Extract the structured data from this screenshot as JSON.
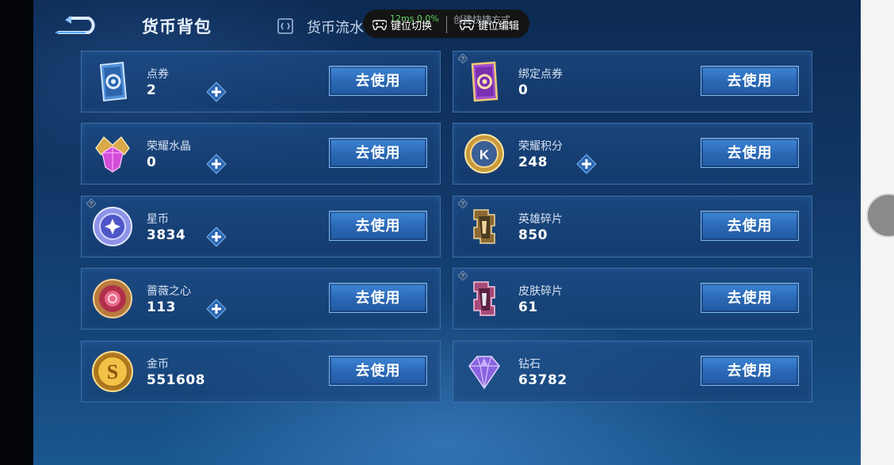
{
  "header": {
    "title": "货币背包",
    "flow_tab": "货币流水",
    "back_icon": "back-arrow-icon"
  },
  "overlay": {
    "ghost_left": "12ms 0.0%",
    "ghost_right": "创建快捷方式",
    "key_switch": "键位切换",
    "key_edit": "键位编辑",
    "icon": "gamepad-icon"
  },
  "currencies": [
    {
      "name": "点券",
      "value": "2",
      "icon": "coupon-card-icon",
      "has_plus": true,
      "has_help": false
    },
    {
      "name": "绑定点券",
      "value": "0",
      "icon": "bound-coupon-card-icon",
      "has_plus": false,
      "has_help": true
    },
    {
      "name": "荣耀水晶",
      "value": "0",
      "icon": "glory-crystal-icon",
      "has_plus": true,
      "has_help": false
    },
    {
      "name": "荣耀积分",
      "value": "248",
      "icon": "glory-points-icon",
      "has_plus": true,
      "has_help": false
    },
    {
      "name": "星币",
      "value": "3834",
      "icon": "star-coin-icon",
      "has_plus": true,
      "has_help": true
    },
    {
      "name": "英雄碎片",
      "value": "850",
      "icon": "hero-fragment-icon",
      "has_plus": false,
      "has_help": true
    },
    {
      "name": "蔷薇之心",
      "value": "113",
      "icon": "rose-heart-icon",
      "has_plus": true,
      "has_help": false
    },
    {
      "name": "皮肤碎片",
      "value": "61",
      "icon": "skin-fragment-icon",
      "has_plus": false,
      "has_help": true
    },
    {
      "name": "金币",
      "value": "551608",
      "icon": "gold-coin-icon",
      "has_plus": false,
      "has_help": false
    },
    {
      "name": "钻石",
      "value": "63782",
      "icon": "diamond-icon",
      "has_plus": false,
      "has_help": false
    }
  ],
  "use_label": "去使用",
  "colors": {
    "accent": "#2a67b4",
    "panel_border": "#3b6ea8",
    "background": "#12396a"
  }
}
